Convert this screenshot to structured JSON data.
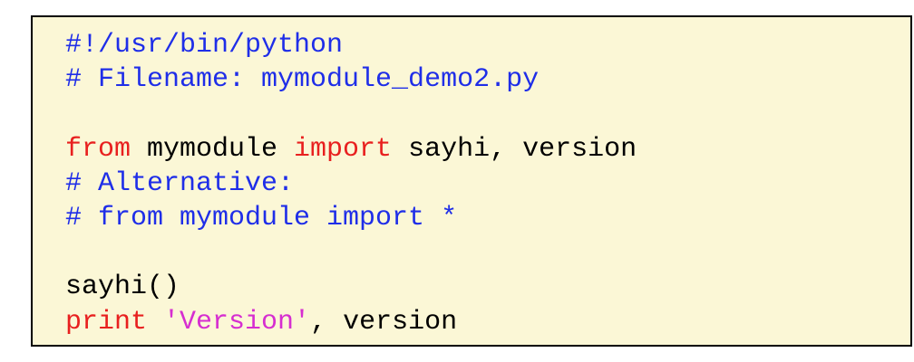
{
  "colors": {
    "background": "#fbf7d6",
    "border": "#000000",
    "comment": "#1f2ee8",
    "keyword": "#e8201f",
    "string": "#d62ed0",
    "plain": "#000000"
  },
  "code": {
    "lines": [
      [
        {
          "type": "comment",
          "text": "#!/usr/bin/python"
        }
      ],
      [
        {
          "type": "comment",
          "text": "# Filename: mymodule_demo2.py"
        }
      ],
      [],
      [
        {
          "type": "keyword",
          "text": "from"
        },
        {
          "type": "plain",
          "text": " mymodule "
        },
        {
          "type": "keyword",
          "text": "import"
        },
        {
          "type": "plain",
          "text": " sayhi, version"
        }
      ],
      [
        {
          "type": "comment",
          "text": "# Alternative:"
        }
      ],
      [
        {
          "type": "comment",
          "text": "# from mymodule import *"
        }
      ],
      [],
      [
        {
          "type": "plain",
          "text": "sayhi()"
        }
      ],
      [
        {
          "type": "keyword",
          "text": "print"
        },
        {
          "type": "plain",
          "text": " "
        },
        {
          "type": "string",
          "text": "'Version'"
        },
        {
          "type": "plain",
          "text": ", version"
        }
      ]
    ]
  }
}
